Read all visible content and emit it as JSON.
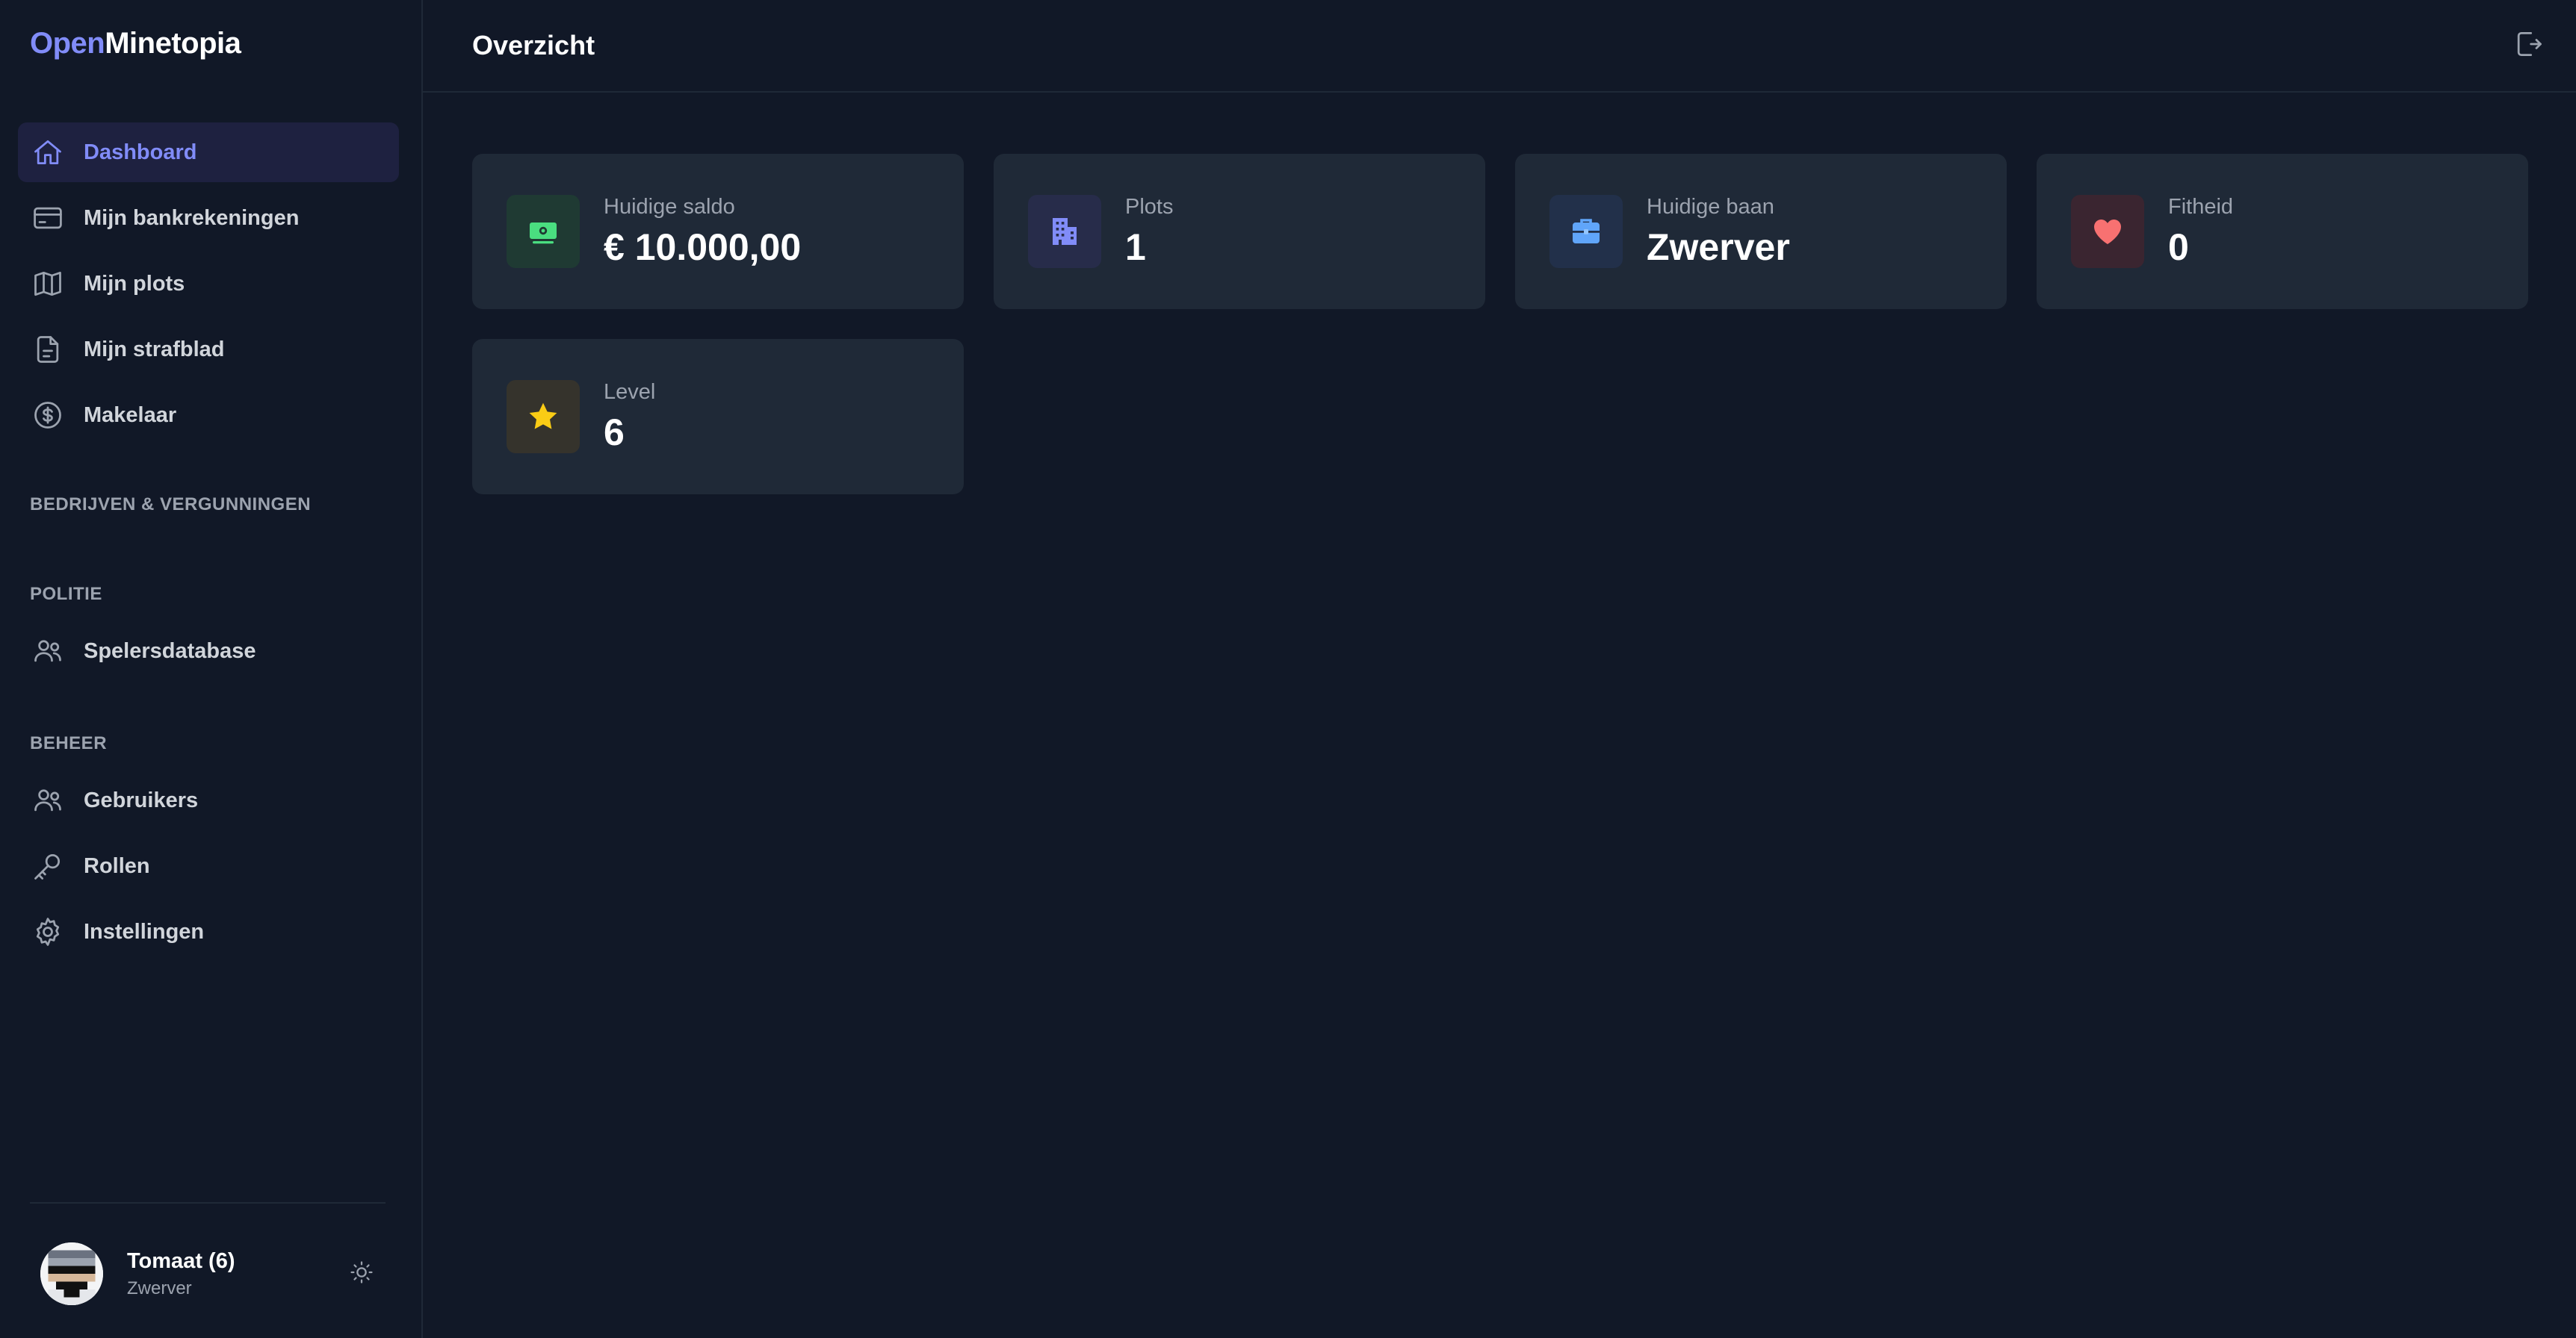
{
  "app": {
    "logo_part1": "Open",
    "logo_part2": "Minetopia"
  },
  "sidebar": {
    "main_items": [
      {
        "label": "Dashboard",
        "icon": "home-icon",
        "active": true
      },
      {
        "label": "Mijn bankrekeningen",
        "icon": "credit-card-icon"
      },
      {
        "label": "Mijn plots",
        "icon": "map-icon"
      },
      {
        "label": "Mijn strafblad",
        "icon": "document-icon"
      },
      {
        "label": "Makelaar",
        "icon": "dollar-circle-icon"
      }
    ],
    "sections": {
      "companies": "BEDRIJVEN & VERGUNNINGEN",
      "police": "POLITIE",
      "admin": "BEHEER"
    },
    "police_items": [
      {
        "label": "Spelersdatabase",
        "icon": "users-icon"
      }
    ],
    "admin_items": [
      {
        "label": "Gebruikers",
        "icon": "users-icon"
      },
      {
        "label": "Rollen",
        "icon": "key-icon"
      },
      {
        "label": "Instellingen",
        "icon": "gear-icon"
      }
    ],
    "user": {
      "name": "Tomaat (6)",
      "role": "Zwerver"
    }
  },
  "header": {
    "title": "Overzicht"
  },
  "stats": [
    {
      "label": "Huidige saldo",
      "value": "€ 10.000,00",
      "icon": "banknote-icon",
      "color": "#4ade80"
    },
    {
      "label": "Plots",
      "value": "1",
      "icon": "building-icon",
      "color": "#818cf8"
    },
    {
      "label": "Huidige baan",
      "value": "Zwerver",
      "icon": "briefcase-icon",
      "color": "#60a5fa"
    },
    {
      "label": "Fitheid",
      "value": "0",
      "icon": "heart-icon",
      "color": "#f87171"
    },
    {
      "label": "Level",
      "value": "6",
      "icon": "star-icon",
      "color": "#facc15"
    }
  ]
}
